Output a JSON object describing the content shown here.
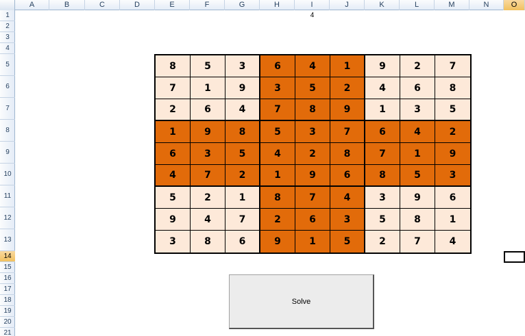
{
  "columns": [
    "A",
    "B",
    "C",
    "D",
    "E",
    "F",
    "G",
    "H",
    "I",
    "J",
    "K",
    "L",
    "M",
    "N",
    "O"
  ],
  "active_column": "O",
  "rows": [
    "1",
    "2",
    "3",
    "4",
    "5",
    "6",
    "7",
    "8",
    "9",
    "10",
    "11",
    "12",
    "13",
    "14",
    "15",
    "16",
    "17",
    "18",
    "19",
    "20",
    "21"
  ],
  "active_row": "14",
  "cell_i1_value": "4",
  "sudoku": [
    [
      "8",
      "5",
      "3",
      "6",
      "4",
      "1",
      "9",
      "2",
      "7"
    ],
    [
      "7",
      "1",
      "9",
      "3",
      "5",
      "2",
      "4",
      "6",
      "8"
    ],
    [
      "2",
      "6",
      "4",
      "7",
      "8",
      "9",
      "1",
      "3",
      "5"
    ],
    [
      "1",
      "9",
      "8",
      "5",
      "3",
      "7",
      "6",
      "4",
      "2"
    ],
    [
      "6",
      "3",
      "5",
      "4",
      "2",
      "8",
      "7",
      "1",
      "9"
    ],
    [
      "4",
      "7",
      "2",
      "1",
      "9",
      "6",
      "8",
      "5",
      "3"
    ],
    [
      "5",
      "2",
      "1",
      "8",
      "7",
      "4",
      "3",
      "9",
      "6"
    ],
    [
      "9",
      "4",
      "7",
      "2",
      "6",
      "3",
      "5",
      "8",
      "1"
    ],
    [
      "3",
      "8",
      "6",
      "9",
      "1",
      "5",
      "2",
      "7",
      "4"
    ]
  ],
  "colors": {
    "light_box": "#fde9d9",
    "dark_box": "#e26b0a"
  },
  "solve_button": {
    "label": "Solve"
  }
}
